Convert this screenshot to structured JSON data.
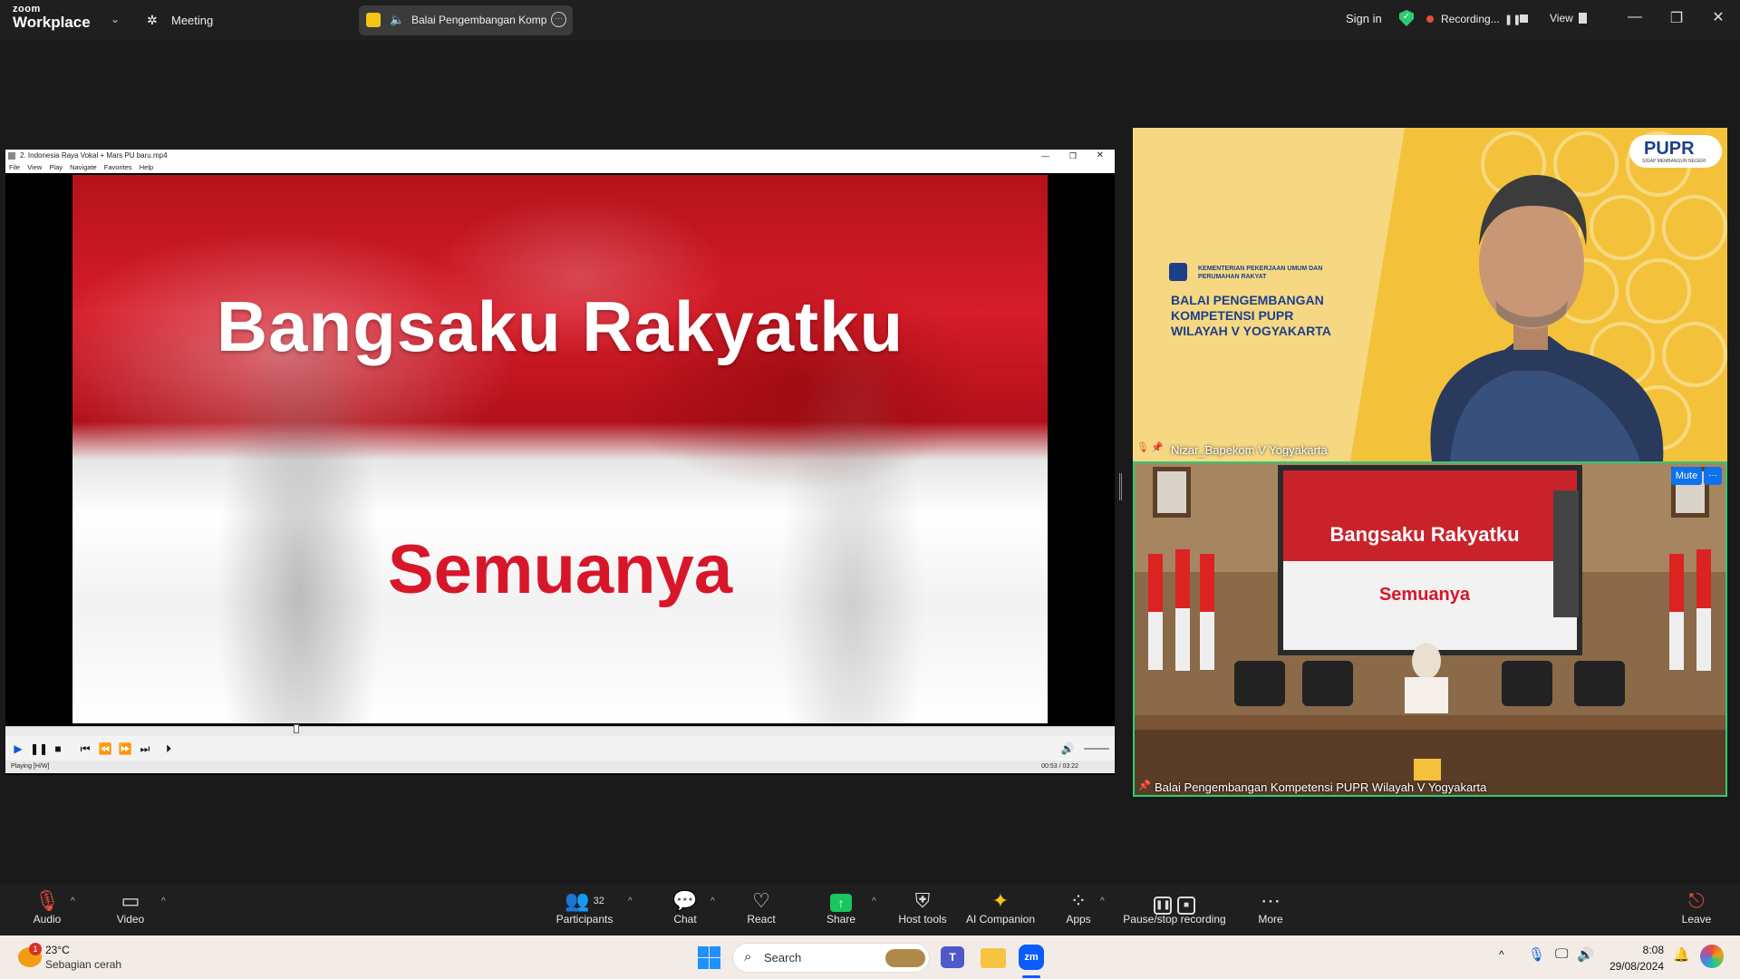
{
  "topbar": {
    "logo_small": "zoom",
    "logo_big": "Workplace",
    "meeting_label": "Meeting",
    "speaker_pill": "Balai Pengembangan Komp",
    "sign_in": "Sign in",
    "recording": "Recording...",
    "view": "View"
  },
  "player": {
    "title": "2. Indonesia Raya Vokal + Mars PU baru.mp4",
    "menu": [
      "File",
      "View",
      "Play",
      "Navigate",
      "Favorites",
      "Help"
    ],
    "lyric_line1": "Bangsaku Rakyatku",
    "lyric_line2": "Semuanya",
    "status": "Playing [H/W]",
    "time": "00:53 / 03:22",
    "progress_fraction": 0.26
  },
  "tile1": {
    "name": "Nizar_Bapekom V Yogyakarta",
    "logo": "PUPR",
    "logo_sub": "SIGAP MEMBANGUN NEGERI",
    "ministry": "KEMENTERIAN PEKERJAAN UMUM DAN PERUMAHAN RAKYAT",
    "banner_l1": "BALAI PENGEMBANGAN",
    "banner_l2": "KOMPETENSI PUPR",
    "banner_l3": "WILAYAH V YOGYAKARTA"
  },
  "tile2": {
    "name": "Balai Pengembangan Kompetensi PUPR Wilayah V Yogyakarta",
    "mute": "Mute",
    "more": "···",
    "screen_line1": "Bangsaku Rakyatku",
    "screen_line2": "Semuanya"
  },
  "toolbar": {
    "audio": "Audio",
    "video": "Video",
    "participants": "Participants",
    "participants_count": "32",
    "chat": "Chat",
    "react": "React",
    "share": "Share",
    "host_tools": "Host tools",
    "ai": "AI Companion",
    "apps": "Apps",
    "pause_stop": "Pause/stop recording",
    "more": "More",
    "leave": "Leave"
  },
  "taskbar": {
    "weather_temp": "23°C",
    "weather_desc": "Sebagian cerah",
    "weather_badge": "1",
    "search": "Search",
    "time": "8:08",
    "date": "29/08/2024"
  },
  "colors": {
    "accent_green": "#2ecc71",
    "share_green": "#19c65f",
    "recording_red": "#e74c3c",
    "flag_red": "#d8162a"
  }
}
